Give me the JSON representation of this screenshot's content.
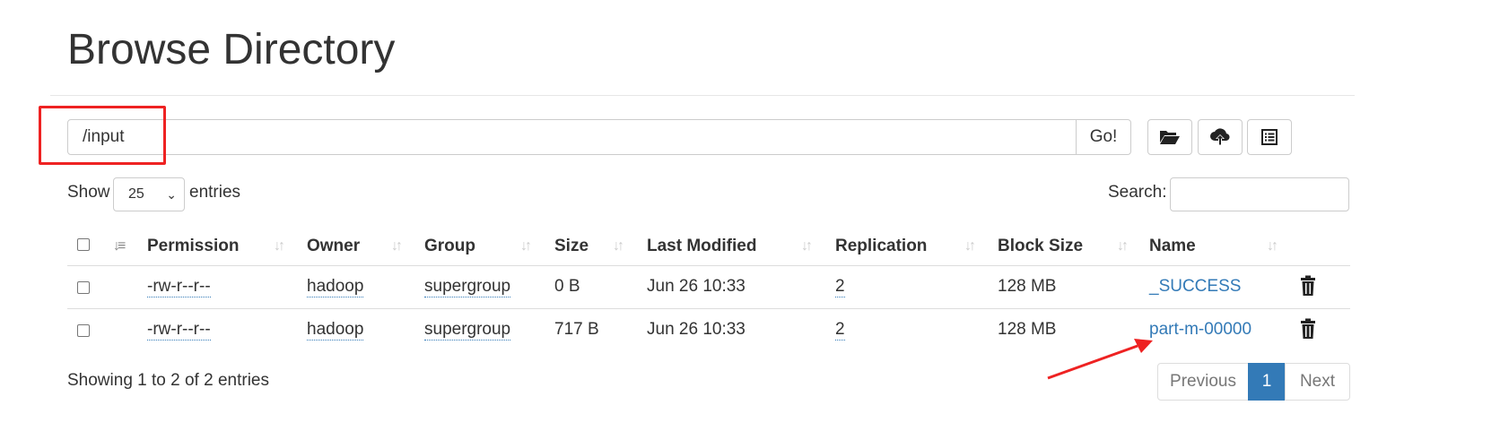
{
  "page": {
    "title": "Browse Directory"
  },
  "path_bar": {
    "value": "/input",
    "go_label": "Go!"
  },
  "toolbar": {
    "buttons": [
      {
        "icon": "folder-open-icon"
      },
      {
        "icon": "cloud-upload-icon"
      },
      {
        "icon": "list-icon"
      }
    ]
  },
  "length": {
    "show_label": "Show",
    "selected": "25",
    "entries_label": "entries"
  },
  "search": {
    "label": "Search:",
    "value": ""
  },
  "table": {
    "headers": [
      "Permission",
      "Owner",
      "Group",
      "Size",
      "Last Modified",
      "Replication",
      "Block Size",
      "Name"
    ],
    "rows": [
      {
        "permission": "-rw-r--r--",
        "owner": "hadoop",
        "group": "supergroup",
        "size": "0 B",
        "modified": "Jun 26 10:33",
        "replication": "2",
        "block_size": "128 MB",
        "name": "_SUCCESS"
      },
      {
        "permission": "-rw-r--r--",
        "owner": "hadoop",
        "group": "supergroup",
        "size": "717 B",
        "modified": "Jun 26 10:33",
        "replication": "2",
        "block_size": "128 MB",
        "name": "part-m-00000"
      }
    ]
  },
  "info": "Showing 1 to 2 of 2 entries",
  "pagination": {
    "previous": "Previous",
    "current": "1",
    "next": "Next"
  },
  "colors": {
    "link": "#337ab7",
    "active_page": "#337ab7",
    "annotation": "#ee2222"
  }
}
